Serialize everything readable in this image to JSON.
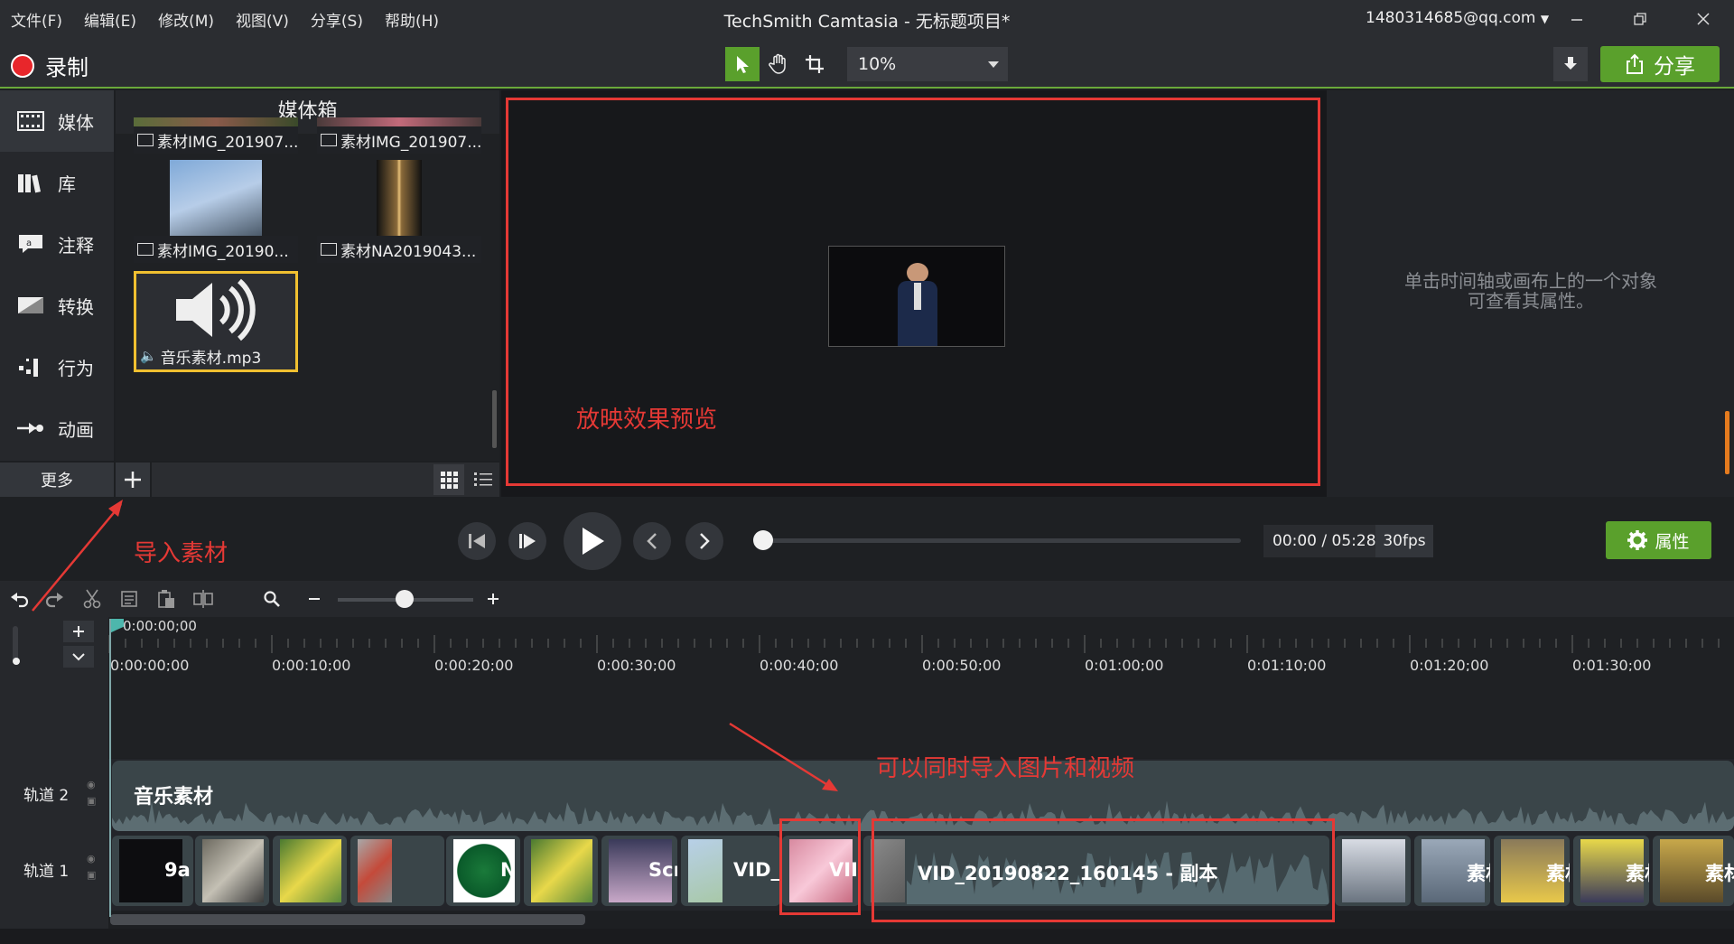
{
  "titlebar": {
    "menu": [
      "文件(F)",
      "编辑(E)",
      "修改(M)",
      "视图(V)",
      "分享(S)",
      "帮助(H)"
    ],
    "title": "TechSmith Camtasia - 无标题项目*",
    "account": "1480314685@qq.com"
  },
  "toolbar": {
    "record_label": "录制",
    "zoom_value": "10%",
    "share_label": "分享"
  },
  "leftnav": {
    "items": [
      {
        "label": "媒体",
        "icon": "media-icon"
      },
      {
        "label": "库",
        "icon": "library-icon"
      },
      {
        "label": "注释",
        "icon": "annotation-icon"
      },
      {
        "label": "转换",
        "icon": "transition-icon"
      },
      {
        "label": "行为",
        "icon": "behavior-icon"
      },
      {
        "label": "动画",
        "icon": "animation-icon"
      }
    ],
    "more_label": "更多"
  },
  "mediabin": {
    "title": "媒体箱",
    "items": [
      {
        "label": "素材IMG_201907..."
      },
      {
        "label": "素材IMG_201907..."
      },
      {
        "label": "素材IMG_20190..."
      },
      {
        "label": "素材NA2019043..."
      },
      {
        "label": "音乐素材.mp3"
      }
    ]
  },
  "canvas": {
    "annotation": "放映效果预览"
  },
  "properties": {
    "hint_line1": "单击时间轴或画布上的一个对象",
    "hint_line2": "可查看其属性。",
    "button_label": "属性"
  },
  "playback": {
    "timecode": "00:00 / 05:28",
    "fps": "30fps",
    "position_fraction": 0.0
  },
  "annotations": {
    "import_label": "导入素材",
    "both_label": "可以同时导入图片和视频"
  },
  "timeline": {
    "playhead": "0:00:00;00",
    "ticks": [
      "0:00:00;00",
      "0:00:10;00",
      "0:00:20;00",
      "0:00:30;00",
      "0:00:40;00",
      "0:00:50;00",
      "0:01:00;00",
      "0:01:10;00",
      "0:01:20;00",
      "0:01:30;00"
    ],
    "tracks": [
      {
        "label": "轨道 2",
        "clip": "音乐素材"
      },
      {
        "label": "轨道 1"
      }
    ],
    "track1_clips": [
      {
        "label": "9a"
      },
      {
        "label": ""
      },
      {
        "label": ""
      },
      {
        "label": ""
      },
      {
        "label": "N"
      },
      {
        "label": ""
      },
      {
        "label": "Scr"
      },
      {
        "label": "VID_"
      },
      {
        "label": "VII"
      },
      {
        "label": "VID_20190822_160145 - 副本"
      },
      {
        "label": ""
      },
      {
        "label": "素材"
      },
      {
        "label": "素材"
      },
      {
        "label": "素材"
      },
      {
        "label": "素材"
      }
    ]
  },
  "colors": {
    "accent_green": "#5aa02c",
    "annotation_red": "#e53935",
    "record_red": "#e8262b"
  }
}
